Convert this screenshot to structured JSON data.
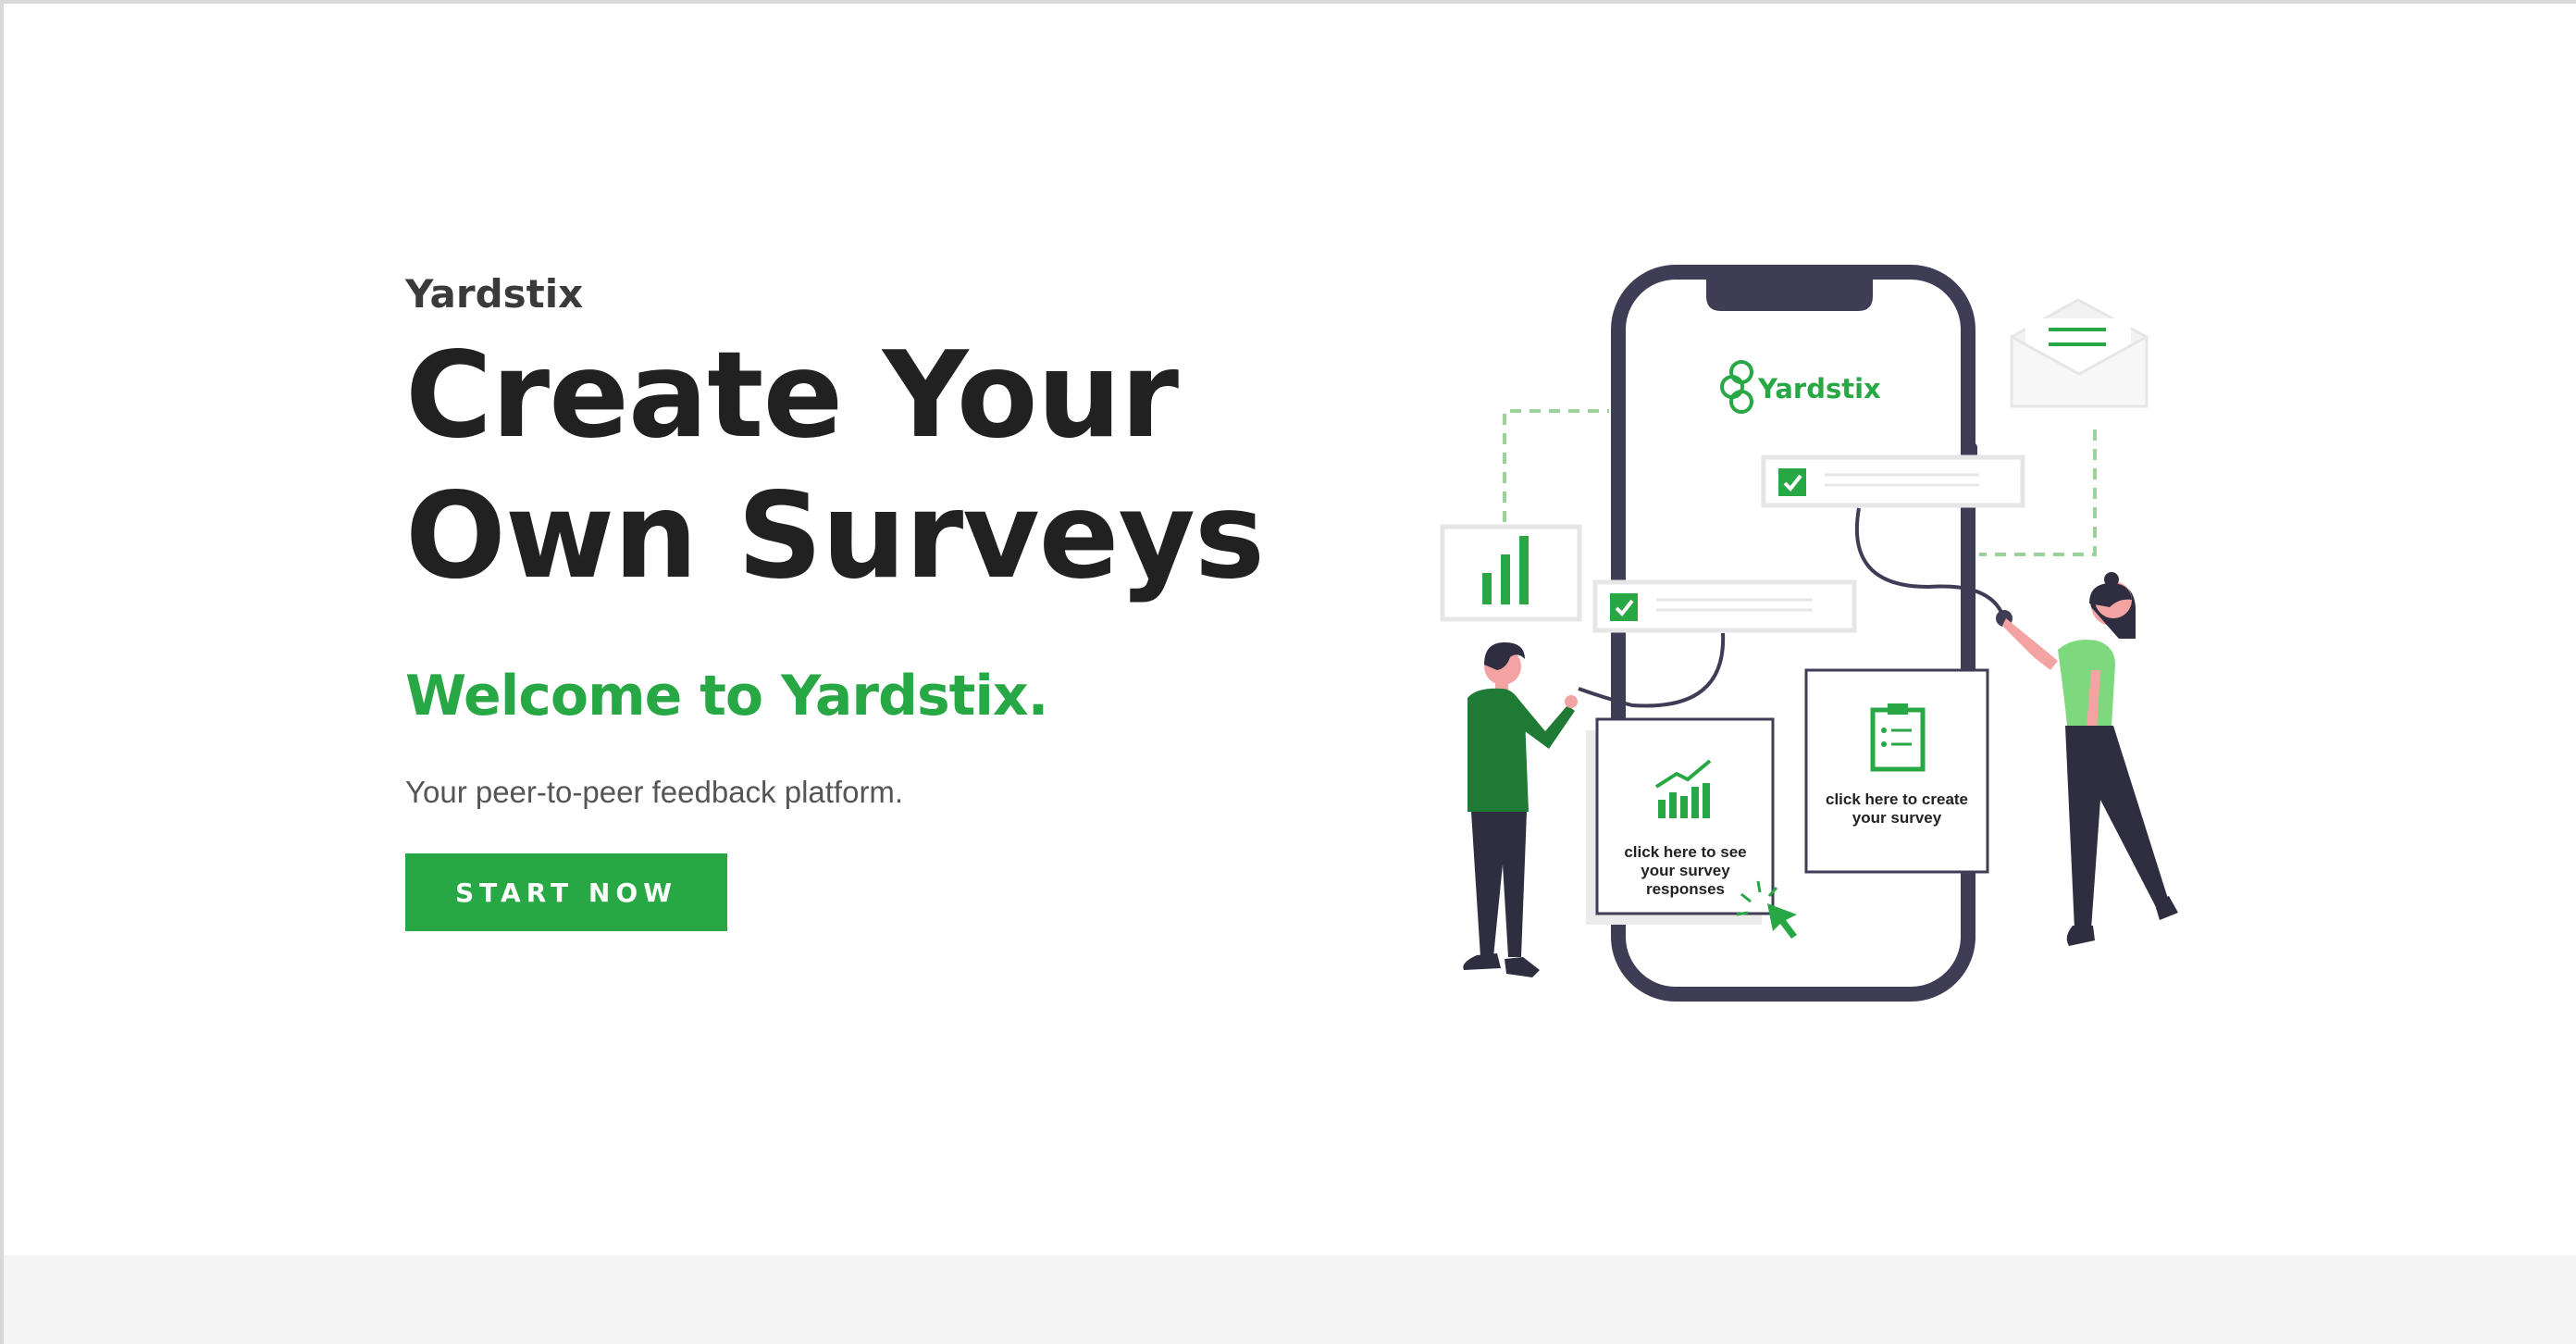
{
  "hero": {
    "brand": "Yardstix",
    "headline_line1": "Create Your",
    "headline_line2": "Own Surveys",
    "welcome": "Welcome to Yardstix.",
    "tagline": "Your peer-to-peer feedback platform.",
    "cta_label": "START NOW"
  },
  "illustration": {
    "app_logo": "Yardstix",
    "card_responses": "click here to see your survey responses",
    "card_create": "click here to create your survey"
  },
  "colors": {
    "accent": "#28a745",
    "headline": "#212121",
    "phone_frame": "#3f3d56",
    "person_shirt_left": "#1e7a35",
    "person_shirt_right": "#7ed87e",
    "skin": "#f4a3a3"
  },
  "icons": {
    "logo": "yardstix-logo-icon",
    "chart": "bar-chart-icon",
    "checkbox": "checkbox-checked-icon",
    "envelope": "envelope-icon",
    "clipboard": "clipboard-icon",
    "cursor": "cursor-pointer-icon",
    "trend": "trend-chart-icon"
  }
}
